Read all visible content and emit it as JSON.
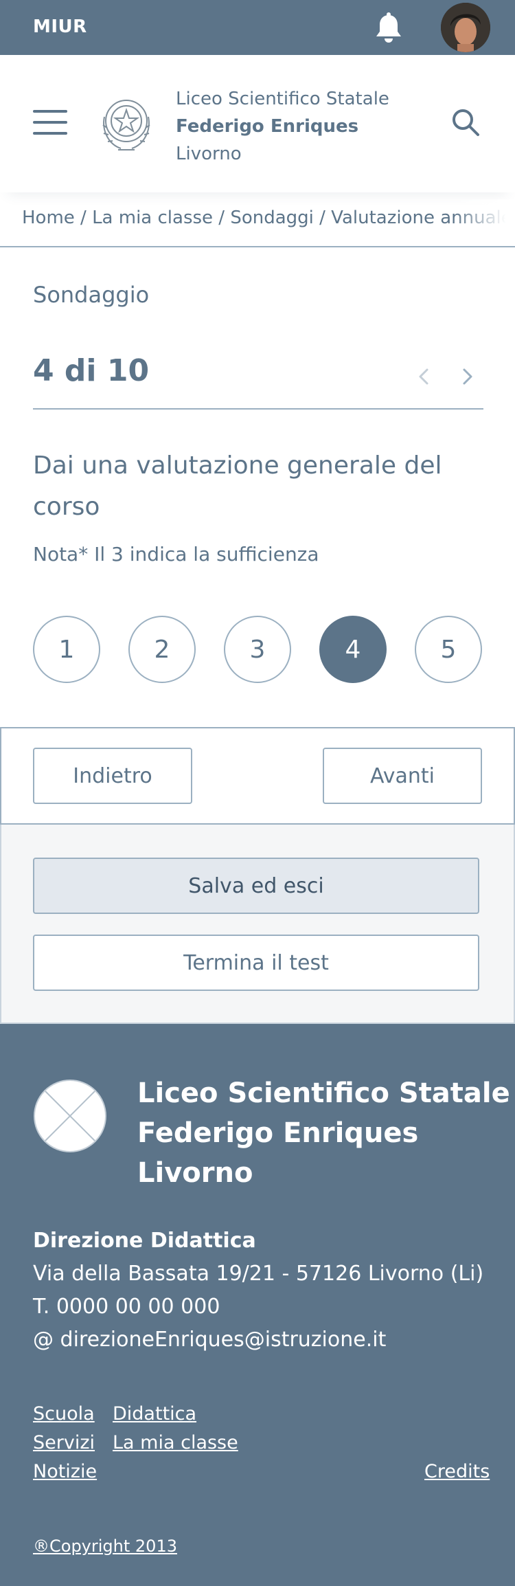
{
  "topbar": {
    "brand": "MIUR",
    "bell_icon": "bell-icon",
    "avatar": "user-avatar"
  },
  "header": {
    "menu_icon": "hamburger-menu-icon",
    "emblem": "repubblica-emblem",
    "school_line1": "Liceo Scientifico Statale",
    "school_line2": "Federigo Enriques",
    "school_line3": "Livorno",
    "search_icon": "search-icon"
  },
  "breadcrumb": {
    "trail": "Home / La mia classe / Sondaggi / Valutazione annuale corso"
  },
  "survey": {
    "label": "Sondaggio",
    "counter": "4 di 10",
    "question": "Dai una valutazione generale del corso",
    "note": "Nota* Il 3 indica la sufficienza",
    "options": [
      "1",
      "2",
      "3",
      "4",
      "5"
    ],
    "selected": "4"
  },
  "nav": {
    "back_label": "Indietro",
    "next_label": "Avanti"
  },
  "actions": {
    "save_label": "Salva ed esci",
    "finish_label": "Termina il test"
  },
  "footer": {
    "title_line1": "Liceo Scientifico Statale",
    "title_line2": "Federigo Enriques",
    "title_line3": "Livorno",
    "direction_label": "Direzione Didattica",
    "address": "Via della Bassata 19/21 - 57126 Livorno (Li)",
    "phone": "T. 0000 00 00 000",
    "email": "@ direzioneEnriques@istruzione.it",
    "links": {
      "scuola": "Scuola",
      "didattica": "Didattica",
      "servizi": "Servizi",
      "la_mia_classe": "La mia classe",
      "notizie": "Notizie",
      "credits": "Credits"
    },
    "copyright": "®Copyright 2013"
  },
  "colors": {
    "primary": "#5c7489",
    "border": "#9bb0c1",
    "save_bg": "#e3e8ee",
    "panel_bg": "#f5f6f7"
  }
}
